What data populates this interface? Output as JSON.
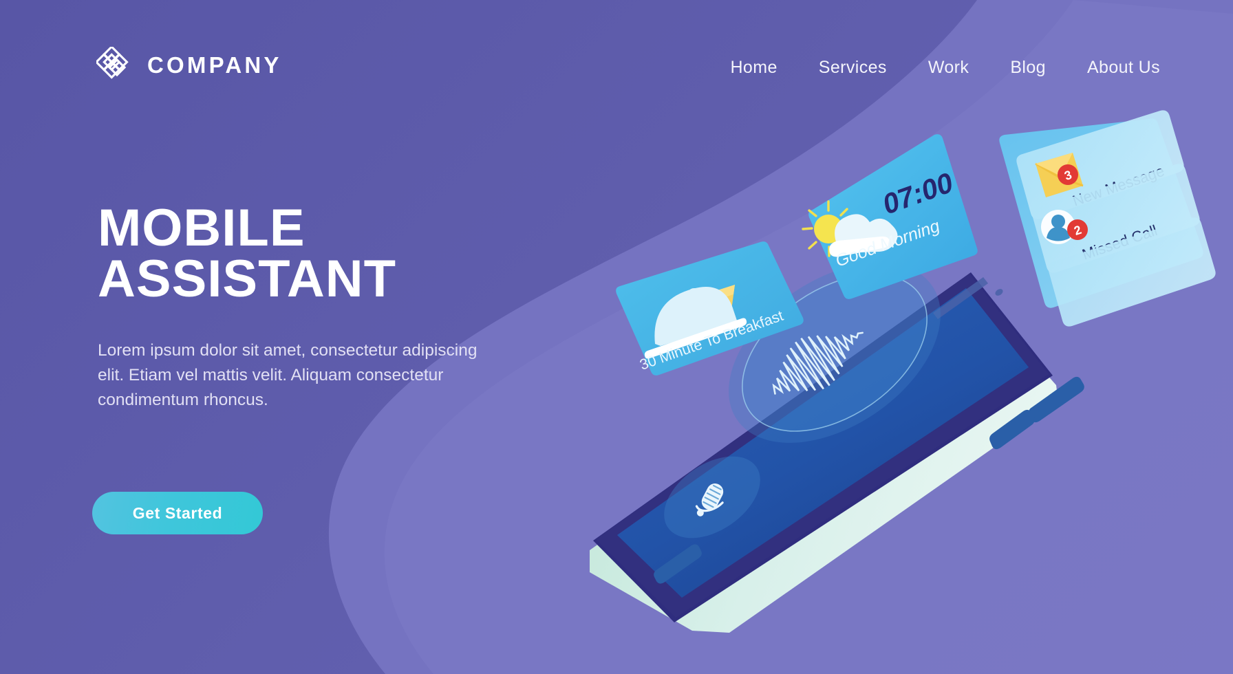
{
  "brand": {
    "name": "COMPANY",
    "logo_icon": "interlocking-diamond-logo"
  },
  "nav": {
    "items": [
      {
        "label": "Home"
      },
      {
        "label": "Services"
      },
      {
        "label": "Work"
      },
      {
        "label": "Blog"
      },
      {
        "label": "About Us"
      }
    ]
  },
  "hero": {
    "title_line1": "MOBILE",
    "title_line2": "ASSISTANT",
    "paragraph": "Lorem ipsum dolor sit amet, consectetur adipiscing elit. Etiam vel mattis velit. Aliquam consectetur condimentum rhoncus.",
    "cta_label": "Get Started"
  },
  "illustration": {
    "breakfast_card": {
      "label": "30 Minute To Breakfast",
      "icons": [
        "food-cloche-icon",
        "juice-glass-icon"
      ]
    },
    "weather_card": {
      "time": "07:00",
      "greeting": "Good Morning",
      "icon": "sun-behind-cloud-icon"
    },
    "notification_card": {
      "rows": [
        {
          "label": "New Message",
          "badge": "3",
          "icon": "envelope-icon"
        },
        {
          "label": "Missed Call",
          "badge": "2",
          "icon": "person-avatar-icon"
        },
        {
          "label": "",
          "badge": "",
          "icon": ""
        }
      ]
    },
    "phone": {
      "waveform_icon": "voice-waveform-icon",
      "mic_icon": "microphone-icon"
    }
  },
  "colors": {
    "background_purple": "#5856a6",
    "background_purple_light": "#7977c4",
    "cta_gradient_start": "#53c3e0",
    "cta_gradient_end": "#33c8d6",
    "card_blue": "#41b4e6",
    "notification_blue": "#5cc3ef",
    "phone_screen": "#1f4f9e",
    "phone_bezel": "#2b2a77",
    "phone_body": "#cfeadd",
    "badge_red": "#e63535",
    "accent_yellow": "#f5cf55",
    "time_navy": "#26266e"
  }
}
